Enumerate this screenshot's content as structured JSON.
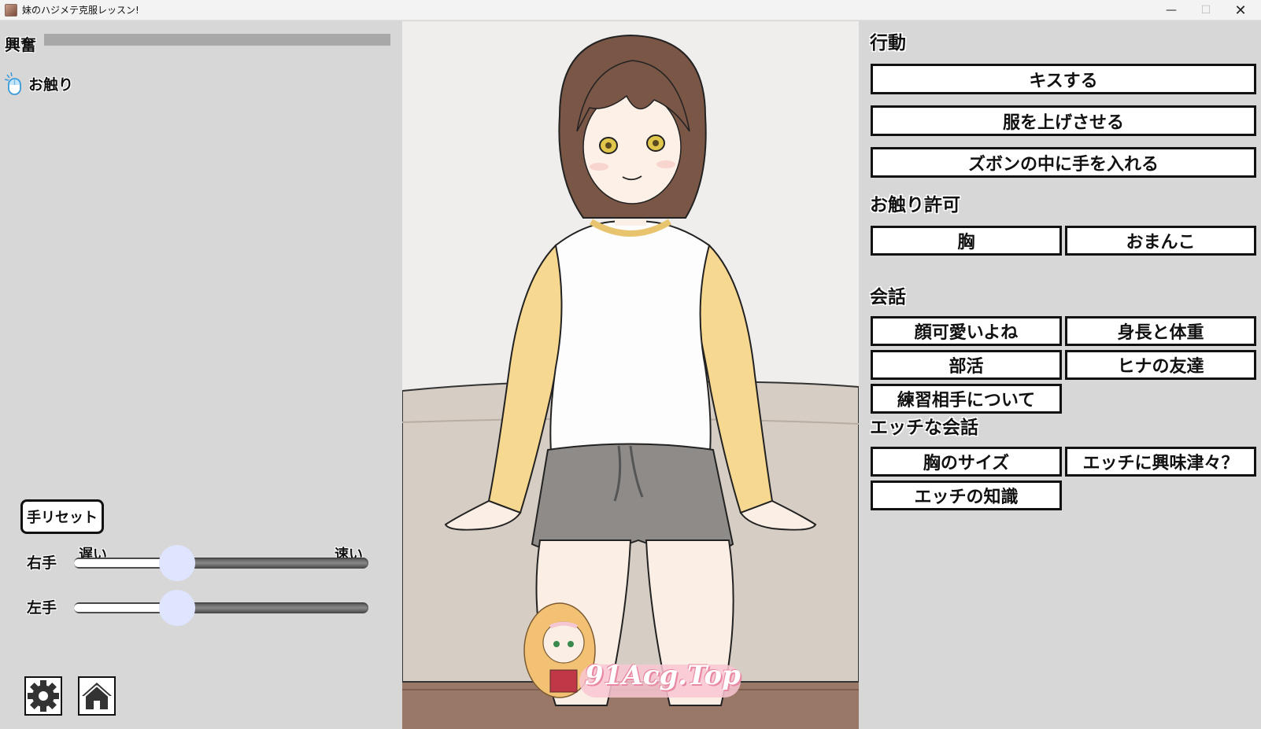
{
  "window": {
    "title": "妹のハジメテ克服レッスン!",
    "min_glyph": "—",
    "max_glyph": "☐",
    "close_glyph": "✕"
  },
  "left": {
    "excite_label": "興奮",
    "excite_level": 0,
    "touch_label": "お触り",
    "reset_button": "手リセット",
    "speed_slow": "遅い",
    "speed_fast": "速い",
    "right_hand_label": "右手",
    "left_hand_label": "左手",
    "right_hand_speed": 0.35,
    "left_hand_speed": 0.35
  },
  "scene": {
    "watermark": "91Acg.Top"
  },
  "right": {
    "action_head": "行動",
    "actions": [
      "キスする",
      "服を上げさせる",
      "ズボンの中に手を入れる"
    ],
    "permit_head": "お触り許可",
    "permits": [
      "胸",
      "おまんこ"
    ],
    "talk_head": "会話",
    "talks": [
      "顔可愛いよね",
      "身長と体重",
      "部活",
      "ヒナの友達",
      "練習相手について"
    ],
    "h_talk_head": "エッチな会話",
    "h_talks": [
      "胸のサイズ",
      "エッチに興味津々？",
      "エッチの知識"
    ]
  },
  "colors": {
    "panel_bg": "#d7d7d7",
    "excite_bar": "#a8a8a8",
    "knob": "#dfe4ff"
  }
}
